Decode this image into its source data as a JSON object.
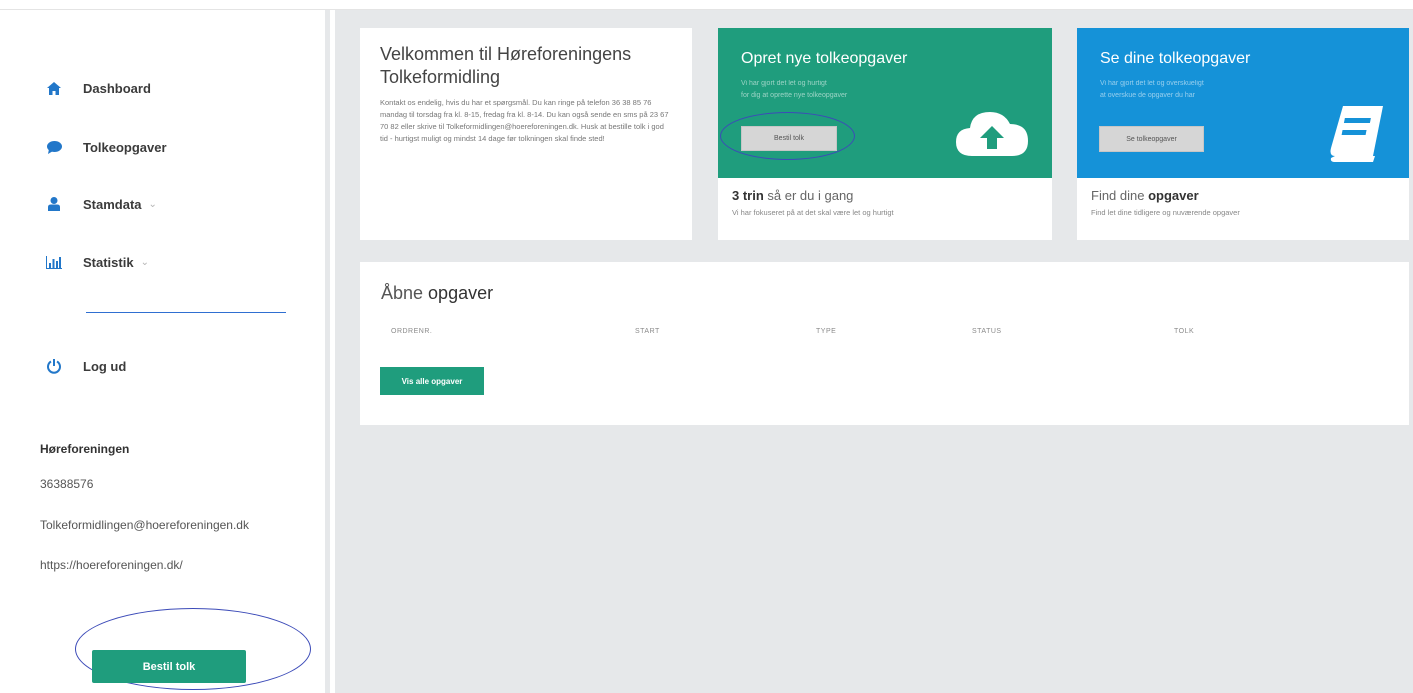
{
  "sidebar": {
    "nav": [
      {
        "label": "Dashboard",
        "icon": "home-icon"
      },
      {
        "label": "Tolkeopgaver",
        "icon": "chat-bubble-icon"
      },
      {
        "label": "Stamdata",
        "icon": "user-icon"
      },
      {
        "label": "Statistik",
        "icon": "bar-chart-icon"
      }
    ],
    "logout": {
      "label": "Log ud",
      "icon": "power-icon"
    },
    "org": {
      "name": "Høreforeningen",
      "phone": "36388576",
      "email": "Tolkeformidlingen@hoereforeningen.dk",
      "url": "https://hoereforeningen.dk/"
    },
    "order_button": "Bestil tolk"
  },
  "welcome": {
    "title": "Velkommen til Høreforeningens Tolkeformidling",
    "text": "Kontakt os endelig, hvis du har et spørgsmål. Du kan ringe på telefon 36 38 85 76 mandag til torsdag fra kl. 8-15, fredag fra kl. 8-14. Du kan også sende en sms på 23 67 70 82 eller skrive til Tolkeformidlingen@hoereforeningen.dk. Husk at bestille tolk i god tid - hurtigst muligt og mindst 14 dage før tolkningen skal finde sted!"
  },
  "create_card": {
    "title": "Opret nye tolkeopgaver",
    "sub1": "Vi har gjort det let og hurtigt",
    "sub2": "for dig at oprette nye tolkeopgaver",
    "button": "Bestil tolk",
    "icon": "cloud-upload-icon",
    "bottom_bold": "3 trin",
    "bottom_rest": " så er du i gang",
    "bottom_sub": "Vi har fokuseret på at det skal være let og hurtigt",
    "color": "#1f9d7d"
  },
  "view_card": {
    "title": "Se dine tolkeopgaver",
    "sub1": "Vi har gjort det let og overskueligt",
    "sub2": "at overskue de opgaver du har",
    "button": "Se tolkeopgaver",
    "icon": "book-icon",
    "bottom_plain": "Find dine ",
    "bottom_bold": "opgaver",
    "bottom_sub": "Find let dine tidligere og nuværende opgaver",
    "color": "#1592d8"
  },
  "open_tasks": {
    "title_plain": "Åbne ",
    "title_bold": "opgaver",
    "columns": [
      "ORDRENR.",
      "START",
      "TYPE",
      "STATUS",
      "TOLK"
    ],
    "button": "Vis alle opgaver"
  }
}
